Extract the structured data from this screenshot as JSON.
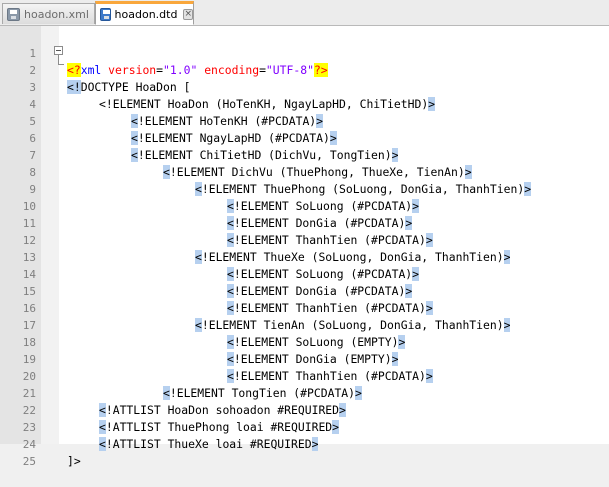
{
  "tabs": [
    {
      "label": "hoadon.xml",
      "active": false,
      "icon": "disk-icon"
    },
    {
      "label": "hoadon.dtd",
      "active": true,
      "icon": "disk-icon"
    }
  ],
  "editor": {
    "lines": [
      {
        "no": "1"
      },
      {
        "no": "2",
        "text": "DOCTYPE HoaDon ["
      },
      {
        "no": "3",
        "text": "<!ELEMENT HoaDon (HoTenKH, NgayLapHD, ChiTietHD)"
      },
      {
        "no": "4",
        "text": "!ELEMENT HoTenKH (#PCDATA)"
      },
      {
        "no": "5",
        "text": "!ELEMENT NgayLapHD (#PCDATA)"
      },
      {
        "no": "6",
        "text": "!ELEMENT ChiTietHD (DichVu, TongTien)"
      },
      {
        "no": "7",
        "text": "!ELEMENT DichVu (ThuePhong, ThueXe, TienAn)"
      },
      {
        "no": "8",
        "text": "!ELEMENT ThuePhong (SoLuong, DonGia, ThanhTien)"
      },
      {
        "no": "9",
        "text": "!ELEMENT SoLuong (#PCDATA)"
      },
      {
        "no": "10",
        "text": "!ELEMENT DonGia (#PCDATA)"
      },
      {
        "no": "11",
        "text": "!ELEMENT ThanhTien (#PCDATA)"
      },
      {
        "no": "12",
        "text": "!ELEMENT ThueXe (SoLuong, DonGia, ThanhTien)"
      },
      {
        "no": "13",
        "text": "!ELEMENT SoLuong (#PCDATA)"
      },
      {
        "no": "14",
        "text": "!ELEMENT DonGia (#PCDATA)"
      },
      {
        "no": "15",
        "text": "!ELEMENT ThanhTien (#PCDATA)"
      },
      {
        "no": "16",
        "text": "!ELEMENT TienAn (SoLuong, DonGia, ThanhTien)"
      },
      {
        "no": "17",
        "text": "!ELEMENT SoLuong (EMPTY)"
      },
      {
        "no": "18",
        "text": "!ELEMENT DonGia (EMPTY)"
      },
      {
        "no": "19",
        "text": "!ELEMENT ThanhTien (#PCDATA)"
      },
      {
        "no": "20",
        "text": "!ELEMENT TongTien (#PCDATA)"
      },
      {
        "no": "21",
        "text": "!ATTLIST HoaDon sohoadon #REQUIRED"
      },
      {
        "no": "22",
        "text": "!ATTLIST ThuePhong loai #REQUIRED"
      },
      {
        "no": "23",
        "text": "!ATTLIST ThueXe loai #REQUIRED"
      },
      {
        "no": "24"
      },
      {
        "no": "25"
      }
    ],
    "xml_decl": {
      "open": "<?",
      "name": "xml",
      "attr1": "version",
      "val1": "\"1.0\"",
      "attr2": "encoding",
      "val2": "\"UTF-8\"",
      "close": "?>"
    },
    "open_bracket": "<",
    "close_bracket": ">",
    "doctype_open": "<!",
    "dtd_end": "]>"
  },
  "colors": {
    "bracket_highlight": "#b6d0ef",
    "xml_decl_highlight": "#ffff00",
    "active_tab_accent": "#f9a73c"
  }
}
